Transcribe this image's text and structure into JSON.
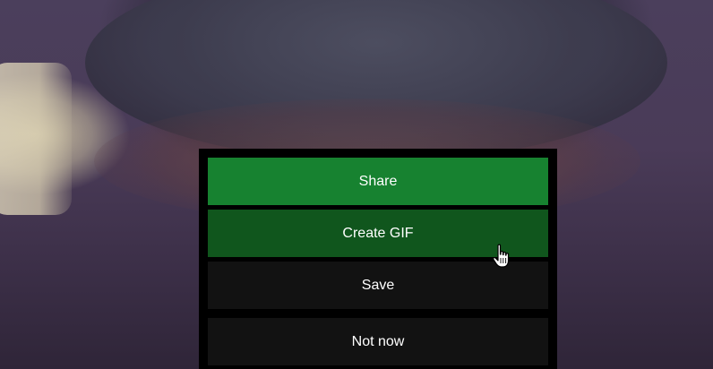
{
  "dialog": {
    "share_label": "Share",
    "create_gif_label": "Create GIF",
    "save_label": "Save",
    "not_now_label": "Not now",
    "hovered_item": "Create GIF"
  },
  "colors": {
    "share_bg": "#178230",
    "create_gif_hover_bg": "#10561d",
    "neutral_button_bg": "#121212",
    "dialog_bg": "#000000"
  },
  "icons": {
    "cursor": "hand-pointer-icon"
  }
}
